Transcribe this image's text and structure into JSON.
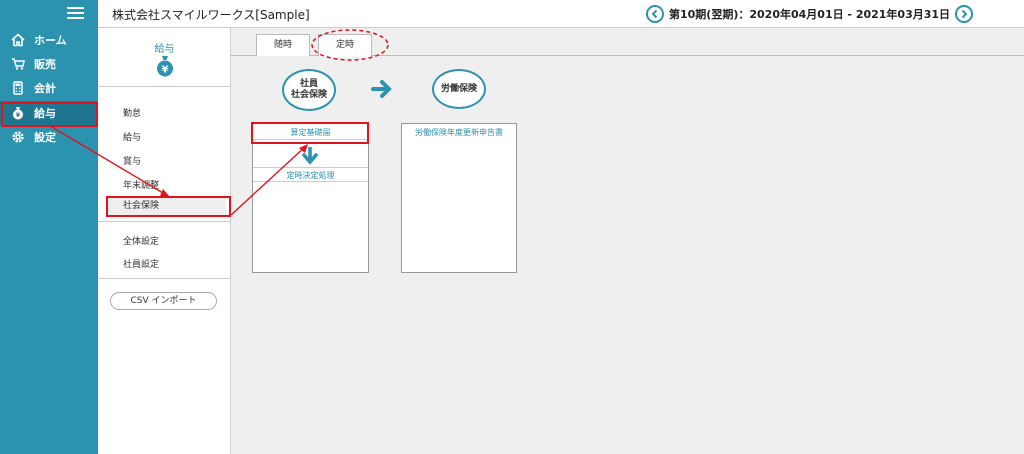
{
  "nav": {
    "items": [
      {
        "label": "ホーム",
        "icon": "home-icon"
      },
      {
        "label": "販売",
        "icon": "cart-icon"
      },
      {
        "label": "会計",
        "icon": "calculator-icon"
      },
      {
        "label": "給与",
        "icon": "money-bag-icon"
      },
      {
        "label": "設定",
        "icon": "gear-icon"
      }
    ],
    "active": "給与"
  },
  "header": {
    "company": "株式会社スマイルワークス[Sample]",
    "period": "第10期(翌期)：2020年04月01日 - 2021年03月31日"
  },
  "subside": {
    "title": "給与",
    "menu_group1": [
      "勤怠",
      "給与",
      "賞与",
      "年末調整",
      "社会保険"
    ],
    "menu_group2": [
      "全体設定",
      "社員設定"
    ],
    "csv_button": "CSV インポート",
    "active": "社会保険"
  },
  "main": {
    "tabs": [
      "随時",
      "定時"
    ],
    "active_tab": "定時",
    "circle1": "社員\n社会保険",
    "circle2": "労働保険",
    "panel1_items": [
      "算定基礎届",
      "定時決定処理"
    ],
    "panel2_items": [
      "労働保険年度更新申告書"
    ]
  },
  "colors": {
    "accent": "#2b93b0",
    "highlight": "#e0141e"
  }
}
